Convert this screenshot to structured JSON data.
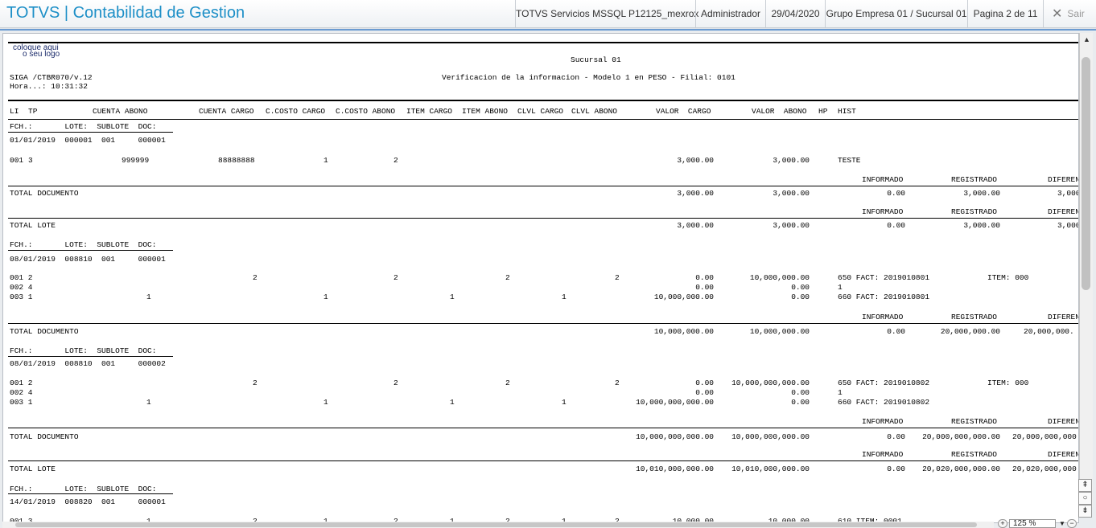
{
  "header": {
    "app_title": "TOTVS | Contabilidad de Gestion",
    "server": "TOTVS Servicios MSSQL P12125_mexrox",
    "user": "Administrador",
    "date": "29/04/2020",
    "branch": "Grupo Empresa 01 / Sucursal 01",
    "page": "Pagina 2 de 11",
    "exit_label": "Sair"
  },
  "report": {
    "logo_line1": "coloque aqui",
    "logo_line2": "o seu logo",
    "sucursal": "Sucursal 01",
    "program": "SIGA /CTBR070/v.12",
    "time": "Hora...: 10:31:32",
    "title": "Verificacion de la informacion - Modelo 1 en PESO - Filial: 0101",
    "columns": {
      "li": "LI",
      "tp": "TP",
      "cuenta_abono": "CUENTA ABONO",
      "cuenta_cargo": "CUENTA CARGO",
      "cc_cargo": "C.COSTO CARGO",
      "cc_abono": "C.COSTO ABONO",
      "item_cargo": "ITEM CARGO",
      "item_abono": "ITEM ABONO",
      "clvl_cargo": "CLVL CARGO",
      "clvl_abono": "CLVL ABONO",
      "valor_cargo": "VALOR  CARGO",
      "valor_abono": "VALOR  ABONO",
      "hp": "HP",
      "hist": "HIST"
    },
    "doc_header": "FCH.:       LOTE:  SUBLOTE  DOC:",
    "summary_labels": {
      "informado": "INFORMADO",
      "registrado": "REGISTRADO",
      "diferencia": "DIFEREN"
    },
    "total_documento": "TOTAL DOCUMENTO",
    "total_lote": "TOTAL LOTE",
    "doc1": {
      "info": "01/01/2019  000001  001     000001"
    },
    "doc1_rows": [
      {
        "li": "001",
        "tp": "3",
        "cuenta_abono": "999999",
        "cuenta_cargo": "88888888",
        "cc_cargo": "1",
        "cc_abono": "2",
        "valor_cargo": "3,000.00",
        "valor_abono": "3,000.00",
        "hist": "TESTE"
      }
    ],
    "doc1_total": {
      "valor_cargo": "3,000.00",
      "valor_abono": "3,000.00",
      "informado": "0.00",
      "registrado": "3,000.00",
      "diferencia": "3,000"
    },
    "lote1_total": {
      "valor_cargo": "3,000.00",
      "valor_abono": "3,000.00",
      "informado": "0.00",
      "registrado": "3,000.00",
      "diferencia": "3,000"
    },
    "doc2": {
      "info": "08/01/2019  008810  001     000001"
    },
    "doc2_rows": [
      {
        "li_tp": "001 2",
        "cc_cargo_col": "2",
        "item_cargo_col": "2",
        "item_abono_col": "2",
        "clvl_abono_col": "2",
        "valor_cargo": "0.00",
        "valor_abono": "10,000,000.00",
        "hist": "650 FACT: 2019010801",
        "extra": "ITEM: 000"
      },
      {
        "li_tp": "002 4",
        "valor_cargo": "0.00",
        "valor_abono": "0.00",
        "hist": "1"
      },
      {
        "li_tp": "003 1",
        "cuenta_abono_col": "1",
        "cc_cargo_col": "1",
        "item_cargo_col": "1",
        "clvl_cargo_col": "1",
        "valor_cargo": "10,000,000.00",
        "valor_abono": "0.00",
        "hist": "660 FACT: 2019010801"
      }
    ],
    "doc2_total": {
      "valor_cargo": "10,000,000.00",
      "valor_abono": "10,000,000.00",
      "informado": "0.00",
      "registrado": "20,000,000.00",
      "diferencia": "20,000,000."
    },
    "doc3": {
      "info": "08/01/2019  008810  001     000002"
    },
    "doc3_rows": [
      {
        "li_tp": "001 2",
        "cc_cargo_col": "2",
        "item_cargo_col": "2",
        "item_abono_col": "2",
        "clvl_abono_col": "2",
        "valor_cargo": "0.00",
        "valor_abono": "10,000,000,000.00",
        "hist": "650 FACT: 2019010802",
        "extra": "ITEM: 000"
      },
      {
        "li_tp": "002 4",
        "valor_cargo": "0.00",
        "valor_abono": "0.00",
        "hist": "1"
      },
      {
        "li_tp": "003 1",
        "cuenta_abono_col": "1",
        "cc_cargo_col": "1",
        "item_cargo_col": "1",
        "clvl_cargo_col": "1",
        "valor_cargo": "10,000,000,000.00",
        "valor_abono": "0.00",
        "hist": "660 FACT: 2019010802"
      }
    ],
    "doc3_total": {
      "valor_cargo": "10,000,000,000.00",
      "valor_abono": "10,000,000,000.00",
      "informado": "0.00",
      "registrado": "20,000,000,000.00",
      "diferencia": "20,000,000,000."
    },
    "lote2_total": {
      "valor_cargo": "10,010,000,000.00",
      "valor_abono": "10,010,000,000.00",
      "informado": "0.00",
      "registrado": "20,020,000,000.00",
      "diferencia": "20,020,000,000."
    },
    "doc4": {
      "info": "14/01/2019  008820  001     000001"
    },
    "doc4_partial": {
      "li_tp": "001 3",
      "c1": "1",
      "c2": "2",
      "c3": "1",
      "c4": "2",
      "c5": "1",
      "c6": "2",
      "c7": "1",
      "c8": "2",
      "valor_cargo": "10,000.00",
      "valor_abono": "10,000.00",
      "hist": "610 ITEM: 0001"
    }
  },
  "viewer": {
    "zoom": "125 %"
  }
}
